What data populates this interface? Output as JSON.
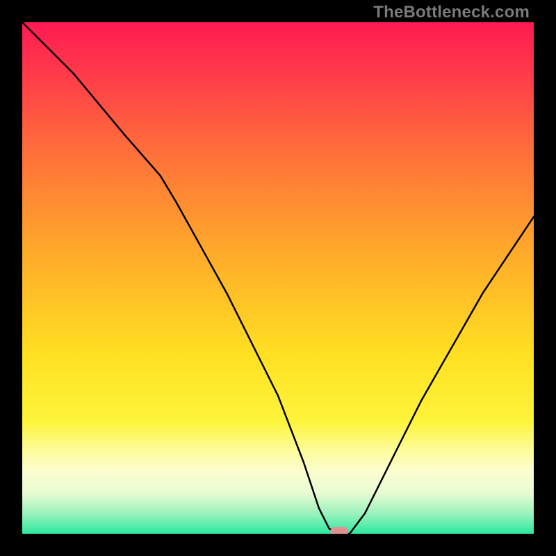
{
  "watermark": "TheBottleneck.com",
  "chart_data": {
    "type": "line",
    "title": "",
    "xlabel": "",
    "ylabel": "",
    "xlim": [
      0,
      100
    ],
    "ylim": [
      0,
      100
    ],
    "grid": false,
    "legend": false,
    "background_gradient": {
      "stops": [
        {
          "offset": 0.0,
          "color": "#ff1a52"
        },
        {
          "offset": 0.1,
          "color": "#ff3a4a"
        },
        {
          "offset": 0.25,
          "color": "#ff6e3a"
        },
        {
          "offset": 0.45,
          "color": "#ffaa2a"
        },
        {
          "offset": 0.65,
          "color": "#ffe022"
        },
        {
          "offset": 0.78,
          "color": "#fdf43a"
        },
        {
          "offset": 0.84,
          "color": "#fdfca0"
        },
        {
          "offset": 0.88,
          "color": "#fbfdd0"
        },
        {
          "offset": 0.92,
          "color": "#e8fbd2"
        },
        {
          "offset": 0.96,
          "color": "#9cf2bc"
        },
        {
          "offset": 1.0,
          "color": "#2ce8a0"
        }
      ]
    },
    "series": [
      {
        "name": "bottleneck-curve",
        "color": "#000000",
        "x": [
          0,
          5,
          10,
          15,
          20,
          27,
          30,
          35,
          40,
          45,
          50,
          55,
          58,
          60,
          62,
          64,
          67,
          70,
          74,
          78,
          82,
          86,
          90,
          94,
          98,
          100
        ],
        "y": [
          100,
          95,
          90,
          84,
          78,
          70,
          65,
          56,
          47,
          37,
          27,
          14,
          5,
          1,
          0,
          0,
          4,
          10,
          18,
          26,
          33,
          40,
          47,
          53,
          59,
          62
        ]
      }
    ],
    "marker": {
      "name": "optimal-point",
      "x": 62,
      "y": 0,
      "color": "#e09090",
      "shape": "rounded-pill"
    }
  }
}
